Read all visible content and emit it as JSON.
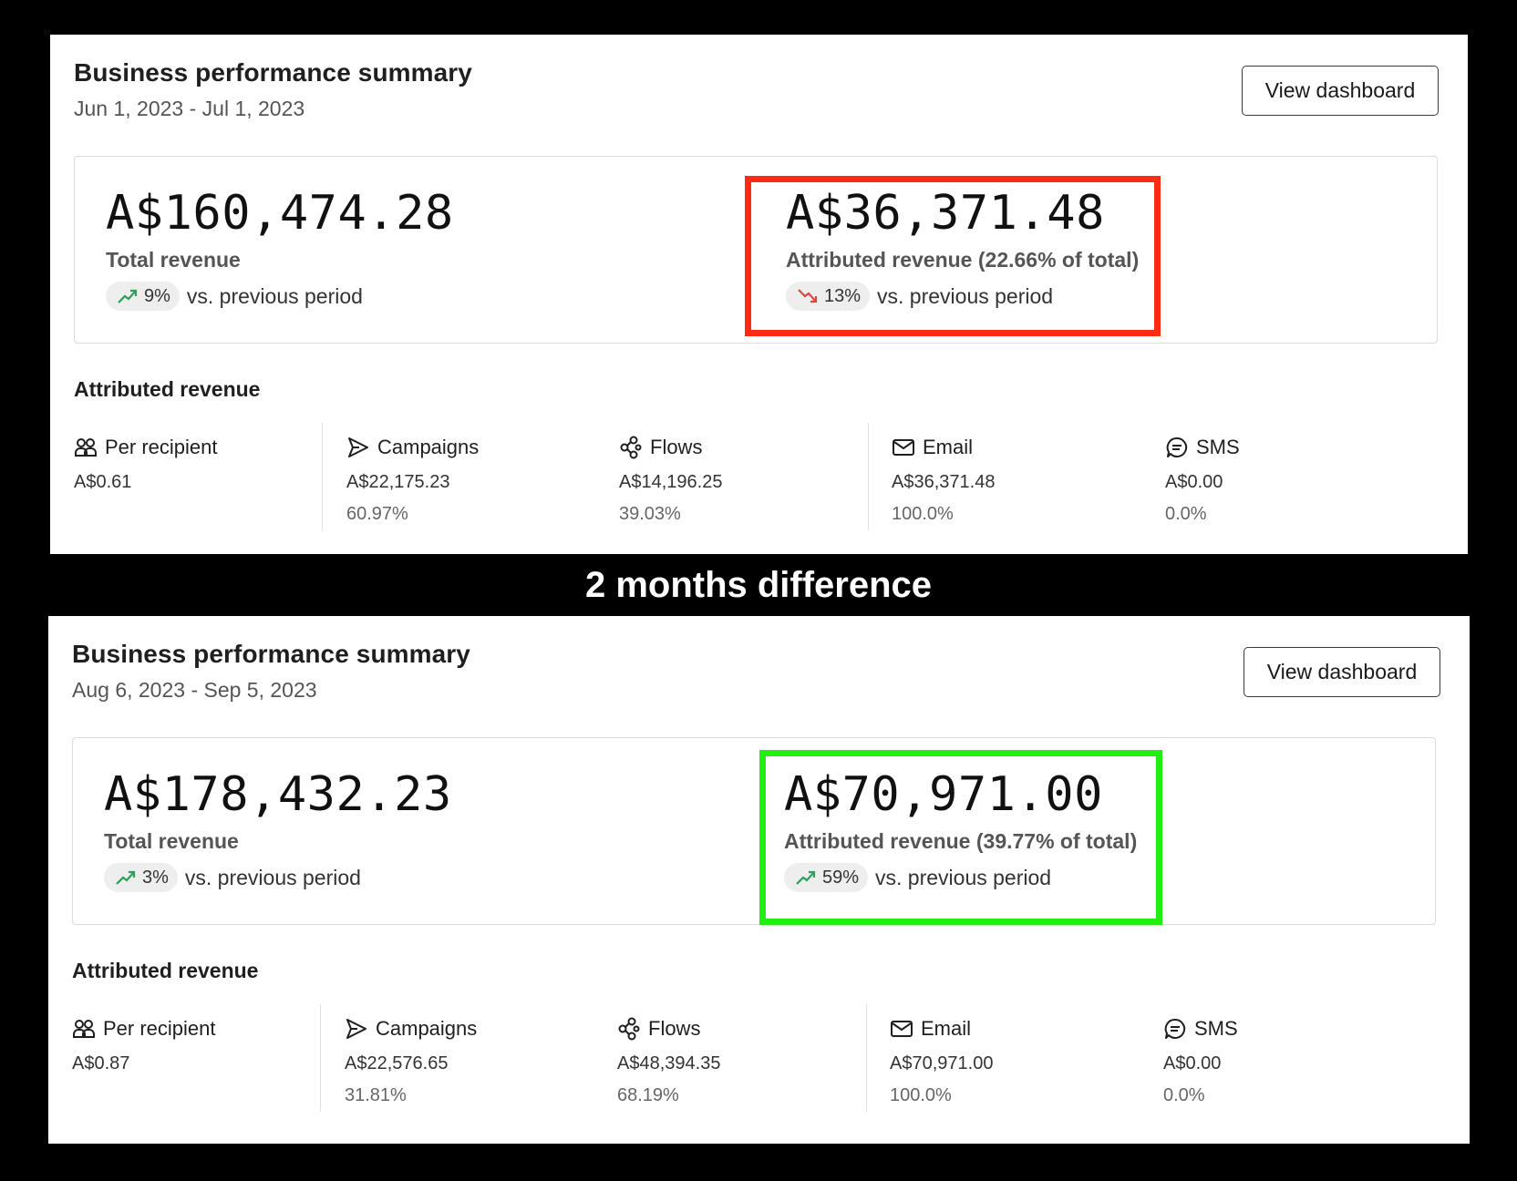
{
  "caption": "2 months difference",
  "colors": {
    "highlight_decline": "#ff2a12",
    "highlight_growth": "#22ee11",
    "trend_up": "#2e9e5b",
    "trend_down": "#e0473a"
  },
  "panels": [
    {
      "title": "Business performance summary",
      "date_range": "Jun 1, 2023 - Jul 1, 2023",
      "view_button": "View dashboard",
      "total": {
        "value": "A$160,474.28",
        "label": "Total revenue",
        "change": "9%",
        "change_direction": "up",
        "change_suffix": "vs. previous period"
      },
      "attributed": {
        "value": "A$36,371.48",
        "label": "Attributed revenue (22.66% of total)",
        "change": "13%",
        "change_direction": "down",
        "change_suffix": "vs. previous period"
      },
      "section_title": "Attributed revenue",
      "channels": [
        {
          "icon": "people-icon",
          "label": "Per recipient",
          "value": "A$0.61",
          "pct": ""
        },
        {
          "icon": "send-icon",
          "label": "Campaigns",
          "value": "A$22,175.23",
          "pct": "60.97%"
        },
        {
          "icon": "flows-icon",
          "label": "Flows",
          "value": "A$14,196.25",
          "pct": "39.03%"
        },
        {
          "icon": "email-icon",
          "label": "Email",
          "value": "A$36,371.48",
          "pct": "100.0%"
        },
        {
          "icon": "sms-icon",
          "label": "SMS",
          "value": "A$0.00",
          "pct": "0.0%"
        }
      ]
    },
    {
      "title": "Business performance summary",
      "date_range": "Aug 6, 2023 - Sep 5, 2023",
      "view_button": "View dashboard",
      "total": {
        "value": "A$178,432.23",
        "label": "Total revenue",
        "change": "3%",
        "change_direction": "up",
        "change_suffix": "vs. previous period"
      },
      "attributed": {
        "value": "A$70,971.00",
        "label": "Attributed revenue (39.77% of total)",
        "change": "59%",
        "change_direction": "up",
        "change_suffix": "vs. previous period"
      },
      "section_title": "Attributed revenue",
      "channels": [
        {
          "icon": "people-icon",
          "label": "Per recipient",
          "value": "A$0.87",
          "pct": ""
        },
        {
          "icon": "send-icon",
          "label": "Campaigns",
          "value": "A$22,576.65",
          "pct": "31.81%"
        },
        {
          "icon": "flows-icon",
          "label": "Flows",
          "value": "A$48,394.35",
          "pct": "68.19%"
        },
        {
          "icon": "email-icon",
          "label": "Email",
          "value": "A$70,971.00",
          "pct": "100.0%"
        },
        {
          "icon": "sms-icon",
          "label": "SMS",
          "value": "A$0.00",
          "pct": "0.0%"
        }
      ]
    }
  ]
}
